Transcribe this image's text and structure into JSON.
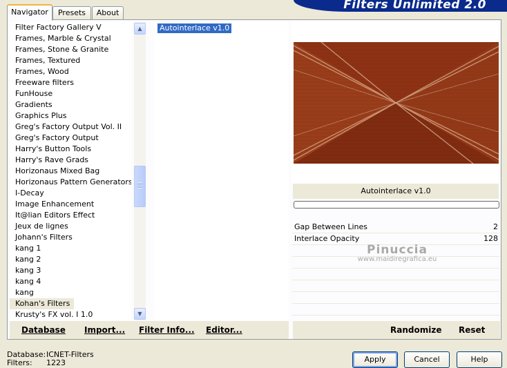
{
  "tabs": [
    "Navigator",
    "Presets",
    "About"
  ],
  "banner": "Filters Unlimited 2.0",
  "categories": [
    "Filter Factory Gallery V",
    "Frames, Marble & Crystal",
    "Frames, Stone & Granite",
    "Frames, Textured",
    "Frames, Wood",
    "Freeware filters",
    "FunHouse",
    "Gradients",
    "Graphics Plus",
    "Greg's Factory Output Vol. II",
    "Greg's Factory Output",
    "Harry's Button Tools",
    "Harry's Rave Grads",
    "Horizonaus Mixed Bag",
    "Horizonaus Pattern Generators",
    "I-Decay",
    "Image Enhancement",
    "It@lian Editors Effect",
    "Jeux de lignes",
    "Johann's Filters",
    "kang 1",
    "kang 2",
    "kang 3",
    "kang 4",
    "kang",
    "Kohan's Filters",
    "Krusty's FX vol. I 1.0"
  ],
  "selected_category": "Kohan's Filters",
  "filters": [
    "Autointerlace v1.0"
  ],
  "filter_title": "Autointerlace v1.0",
  "params": [
    {
      "name": "Gap Between Lines",
      "value": "2"
    },
    {
      "name": "Interlace Opacity",
      "value": "128"
    }
  ],
  "watermark": {
    "name": "Pinuccia",
    "url": "www.maidiregrafica.eu"
  },
  "left_buttons": {
    "database": "Database",
    "import": "Import...",
    "filter_info": "Filter Info...",
    "editor": "Editor..."
  },
  "right_buttons": {
    "randomize": "Randomize",
    "reset": "Reset"
  },
  "status": {
    "database_label": "Database:",
    "database_value": "ICNET-Filters",
    "filters_label": "Filters:",
    "filters_value": "1223"
  },
  "dialog": {
    "apply": "Apply",
    "cancel": "Cancel",
    "help": "Help"
  },
  "colors": {
    "banner": "#0a2a8c",
    "selection": "#316ac5",
    "preview_base": "#8a2e12"
  }
}
